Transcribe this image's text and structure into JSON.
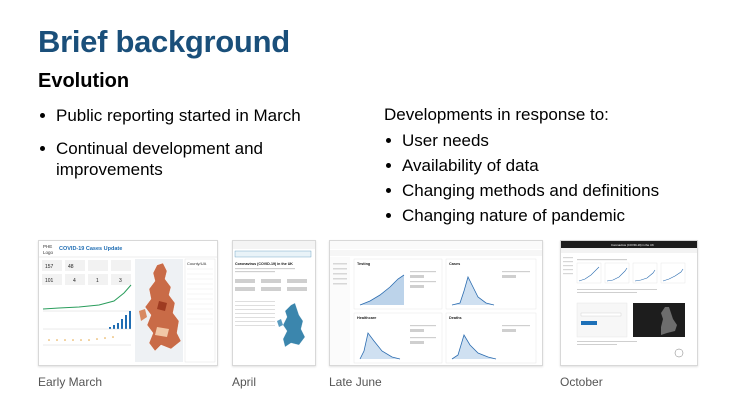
{
  "slide": {
    "title": "Brief background",
    "subtitle": "Evolution",
    "left_bullets": [
      "Public reporting started in March",
      "Continual development and improvements"
    ],
    "developments_heading": "Developments in response to:",
    "right_bullets": [
      "User needs",
      "Availability of data",
      "Changing methods and definitions",
      "Changing nature of pandemic"
    ]
  },
  "screenshots": [
    {
      "caption": "Early March",
      "logo_line1": "PHE",
      "logo_line2": "Logo",
      "header": "COVID-19 Cases Update",
      "counts": [
        "157",
        "48",
        "",
        ""
      ],
      "sub_counts": [
        "101",
        "4",
        "1",
        "3"
      ],
      "panel_label": "County/UA",
      "accent": "#1f6db3"
    },
    {
      "caption": "April",
      "header": "Coronavirus (COVID-19) in the UK",
      "accent": "#2b7aa8",
      "map_color": "#3b86ad"
    },
    {
      "caption": "Late June",
      "panels": [
        "Testing",
        "Cases",
        "Healthcare",
        "Deaths"
      ],
      "accent": "#2b6cb0"
    },
    {
      "caption": "October",
      "header": "Coronavirus (COVID-19) in the UK",
      "accent": "#1d1d1d"
    }
  ]
}
